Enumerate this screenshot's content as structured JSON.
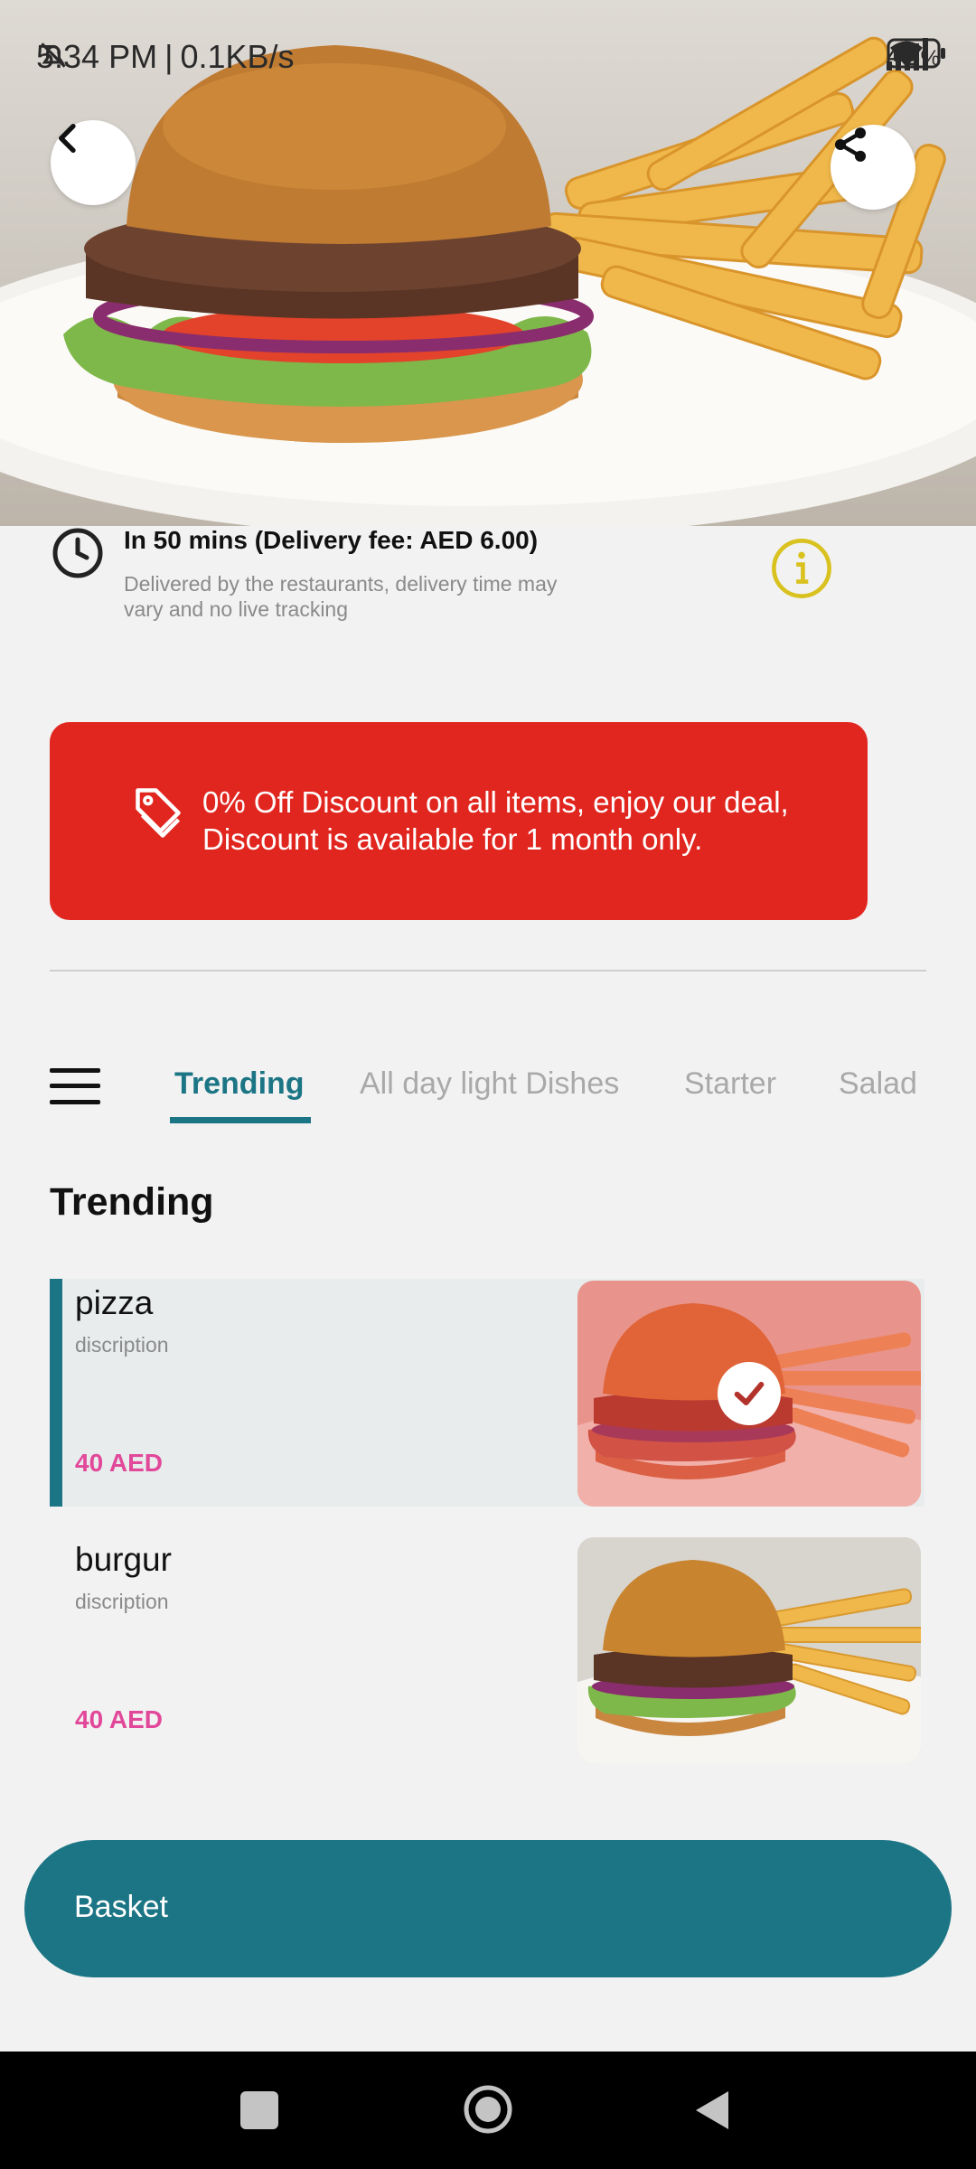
{
  "status_bar": {
    "time": "5:34 PM",
    "separator": "|",
    "speed": "0.1KB/s",
    "battery_percent": "43",
    "battery_unit": "%",
    "icons": [
      "bell-off-icon",
      "signal-icon",
      "signal-icon",
      "wifi-icon",
      "battery-icon"
    ]
  },
  "header": {
    "back_icon": "chevron-left-icon",
    "share_icon": "share-icon"
  },
  "delivery": {
    "title": "In 50 mins (Delivery fee: AED 6.00)",
    "subtitle": "Delivered by the restaurants, delivery time may\n vary and no live tracking",
    "icons": [
      "clock-icon",
      "info-icon"
    ]
  },
  "promo": {
    "text": "0% Off Discount on all items, enjoy our deal,\nDiscount is available for 1 month only.",
    "icon": "tag-icon",
    "color": "#e1261f"
  },
  "tabs": {
    "items": [
      {
        "label": "Trending",
        "active": true
      },
      {
        "label": "All day light Dishes",
        "active": false
      },
      {
        "label": "Starter",
        "active": false
      },
      {
        "label": "Salad",
        "active": false
      }
    ],
    "accent_color": "#1c7585"
  },
  "section": {
    "title": "Trending"
  },
  "items": [
    {
      "name": "pizza",
      "description": "discription",
      "price": "40 AED",
      "selected": true
    },
    {
      "name": "burgur",
      "description": "discription",
      "price": "40 AED",
      "selected": false
    }
  ],
  "basket": {
    "label": "Basket",
    "color": "#1c7585"
  },
  "nav": {
    "icons": [
      "recents-square-icon",
      "home-circle-icon",
      "back-triangle-icon"
    ]
  },
  "colors": {
    "price": "#e2489a",
    "info": "#d9c21f"
  }
}
